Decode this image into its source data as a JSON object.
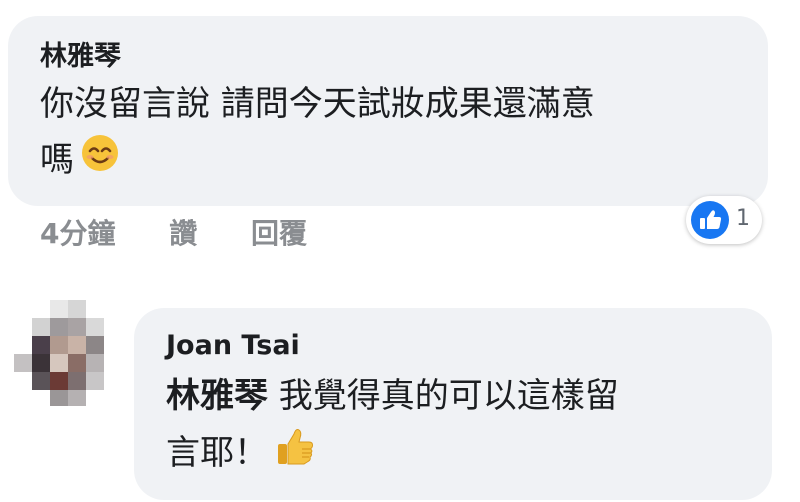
{
  "comment1": {
    "author": "林雅琴",
    "text_line1": "你沒留言說 請問今天試妝成果還滿意",
    "text_line2": "嗎",
    "emoji": "smiling-face",
    "time": "4分鐘",
    "like_action": "讚",
    "reply_action": "回覆",
    "reaction_count": "1"
  },
  "comment2": {
    "author": "Joan Tsai",
    "mention": "林雅琴",
    "text_line1": " 我覺得真的可以這樣留",
    "text_line2": "言耶！",
    "emoji": "thumbs-up"
  },
  "colors": {
    "bubble": "#f0f2f5",
    "like_blue": "#1877f2",
    "meta_gray": "#8a8d91"
  }
}
